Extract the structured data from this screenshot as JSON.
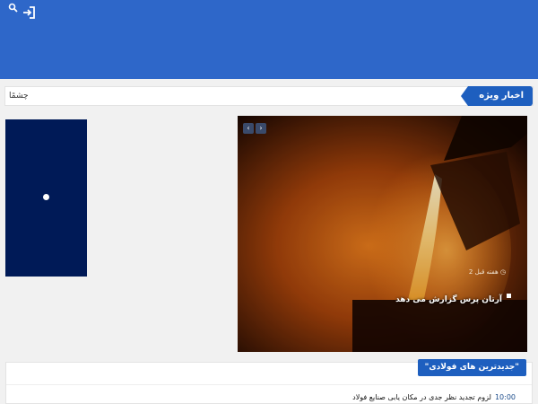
{
  "header": {
    "search_icon": "search-icon",
    "login_icon": "login-icon",
    "color": "#2e67c9"
  },
  "ticker": {
    "label": "اخبار ویژه",
    "text": "چشمًا"
  },
  "slider": {
    "prev_icon": "chevron-left-icon",
    "next_icon": "chevron-right-icon",
    "time": "2 هفته قبل",
    "title": "آرتان پرس گزارش می دهد"
  },
  "latest": {
    "title": "\"جدیدترین های فولادی\"",
    "items": [
      {
        "time": "10:00",
        "title": "لزوم تجدید نظر جدی در مکان یابی صنایع فولاد"
      }
    ]
  }
}
